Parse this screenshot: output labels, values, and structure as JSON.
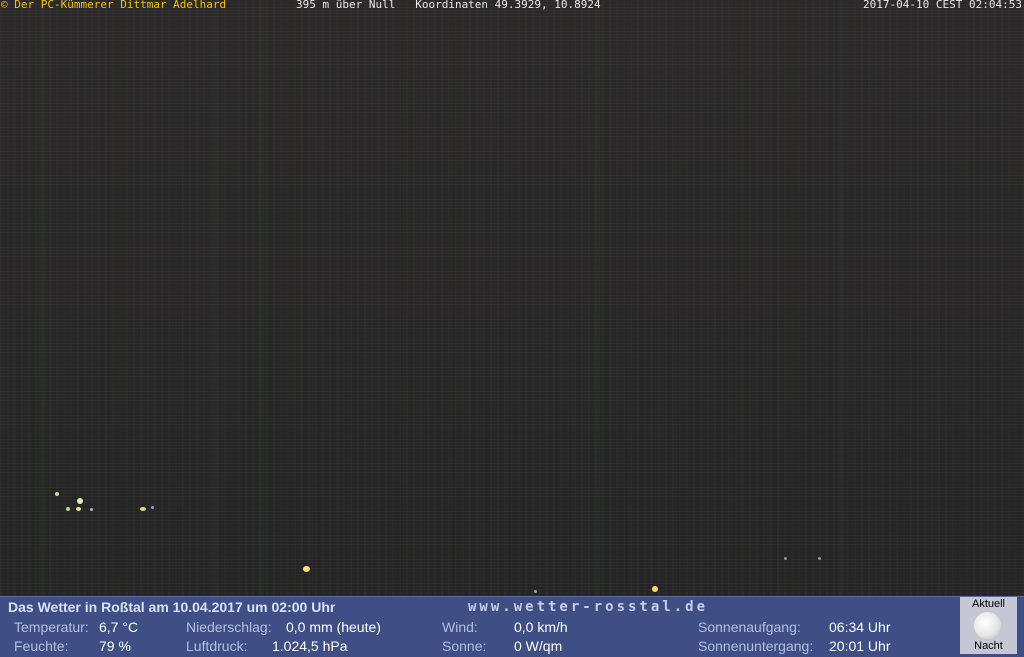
{
  "header": {
    "copyright": "© Der PC-Kümmerer Dittmar Adelhard",
    "location": "395 m über Null   Koordinaten 49.3929, 10.8924",
    "timestamp": "2017-04-10 CEST 02:04:53"
  },
  "weather": {
    "title": "Das Wetter in Roßtal am 10.04.2017 um 02:00 Uhr",
    "website": "www.wetter-rosstal.de",
    "temperature_label": "Temperatur:",
    "temperature_value": "6,7 °C",
    "humidity_label": "Feuchte:",
    "humidity_value": "79 %",
    "precip_label": "Niederschlag:",
    "precip_value": "0,0 mm (heute)",
    "pressure_label": "Luftdruck:",
    "pressure_value": "1.024,5 hPa",
    "wind_label": "Wind:",
    "wind_value": "0,0 km/h",
    "sun_label": "Sonne:",
    "sun_value": "0 W/qm",
    "sunrise_label": "Sonnenaufgang:",
    "sunrise_value": "06:34 Uhr",
    "sunset_label": "Sonnenuntergang:",
    "sunset_value": "20:01 Uhr"
  },
  "moon": {
    "label_top": "Aktuell",
    "label_bottom": "Nacht",
    "icon": "moon-icon"
  },
  "colors": {
    "panel_bg": "#3f4f86",
    "caption_yellow": "#f2c20b",
    "night_sky": "#262525"
  }
}
